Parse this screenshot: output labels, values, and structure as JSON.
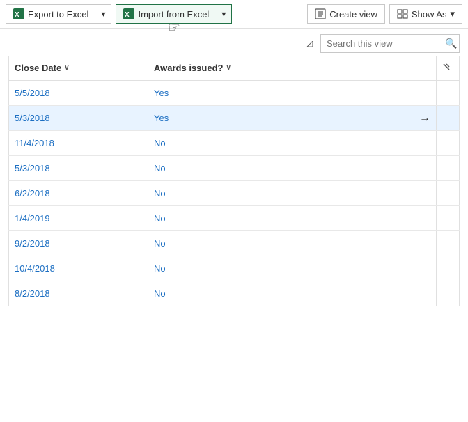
{
  "toolbar": {
    "export_excel_label": "Export to Excel",
    "import_excel_label": "Import from Excel",
    "create_view_label": "Create view",
    "show_as_label": "Show As",
    "dropdown_chevron": "▾",
    "filter_icon": "⊿"
  },
  "search": {
    "placeholder": "Search this view",
    "value": ""
  },
  "table": {
    "columns": [
      {
        "id": "close_date",
        "label": "Close Date",
        "sortable": true
      },
      {
        "id": "awards_issued",
        "label": "Awards issued?",
        "sortable": true
      }
    ],
    "rows": [
      {
        "close_date": "5/5/2018",
        "awards_issued": "Yes",
        "highlighted": false
      },
      {
        "close_date": "5/3/2018",
        "awards_issued": "Yes",
        "highlighted": true,
        "arrow": true
      },
      {
        "close_date": "11/4/2018",
        "awards_issued": "No",
        "highlighted": false
      },
      {
        "close_date": "5/3/2018",
        "awards_issued": "No",
        "highlighted": false
      },
      {
        "close_date": "6/2/2018",
        "awards_issued": "No",
        "highlighted": false
      },
      {
        "close_date": "1/4/2019",
        "awards_issued": "No",
        "highlighted": false
      },
      {
        "close_date": "9/2/2018",
        "awards_issued": "No",
        "highlighted": false
      },
      {
        "close_date": "10/4/2018",
        "awards_issued": "No",
        "highlighted": false
      },
      {
        "close_date": "8/2/2018",
        "awards_issued": "No",
        "highlighted": false
      }
    ]
  }
}
